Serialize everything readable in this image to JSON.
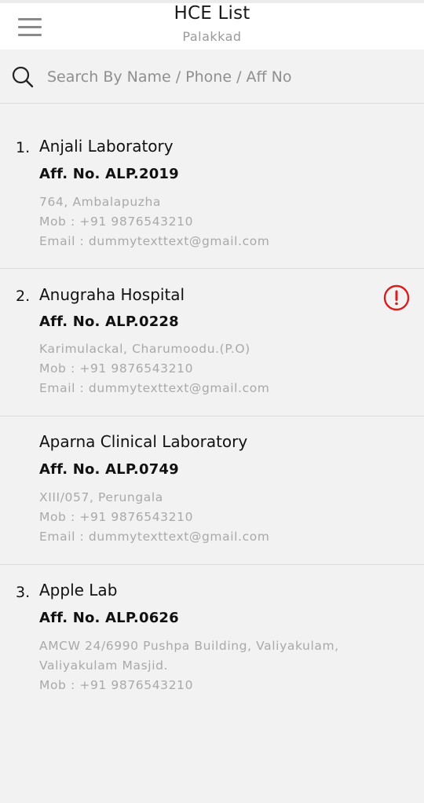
{
  "header": {
    "title": "HCE List",
    "subtitle": "Palakkad"
  },
  "search": {
    "placeholder": "Search By Name / Phone / Aff No",
    "value": ""
  },
  "colors": {
    "alert": "#d81e1e",
    "muted": "#a9a9a9",
    "divider": "#dcdcdc"
  },
  "items": [
    {
      "number": "1.",
      "name": "Anjali Laboratory",
      "aff": "Aff. No. ALP.2019",
      "address": "764, Ambalapuzha",
      "mobile": "Mob : +91 9876543210",
      "email": "Email : dummytexttext@gmail.com"
    },
    {
      "number": "2.",
      "name": "Anugraha Hospital",
      "aff": "Aff. No. ALP.0228",
      "address": "Karimulackal, Charumoodu.(P.O)",
      "mobile": "Mob : +91 9876543210",
      "email": "Email : dummytexttext@gmail.com",
      "icon": "alert-circle-icon"
    },
    {
      "number": "",
      "name": "Aparna Clinical Laboratory",
      "aff": "Aff. No. ALP.0749",
      "address": "XIII/057, Perungala",
      "mobile": "Mob : +91 9876543210",
      "email": "Email : dummytexttext@gmail.com"
    },
    {
      "number": "3.",
      "name": "Apple Lab",
      "aff": "Aff. No. ALP.0626",
      "address": "AMCW 24/6990 Pushpa Building, Valiyakulam,",
      "address_line2": "Valiyakulam Masjid.",
      "mobile": "Mob : +91 9876543210"
    }
  ]
}
